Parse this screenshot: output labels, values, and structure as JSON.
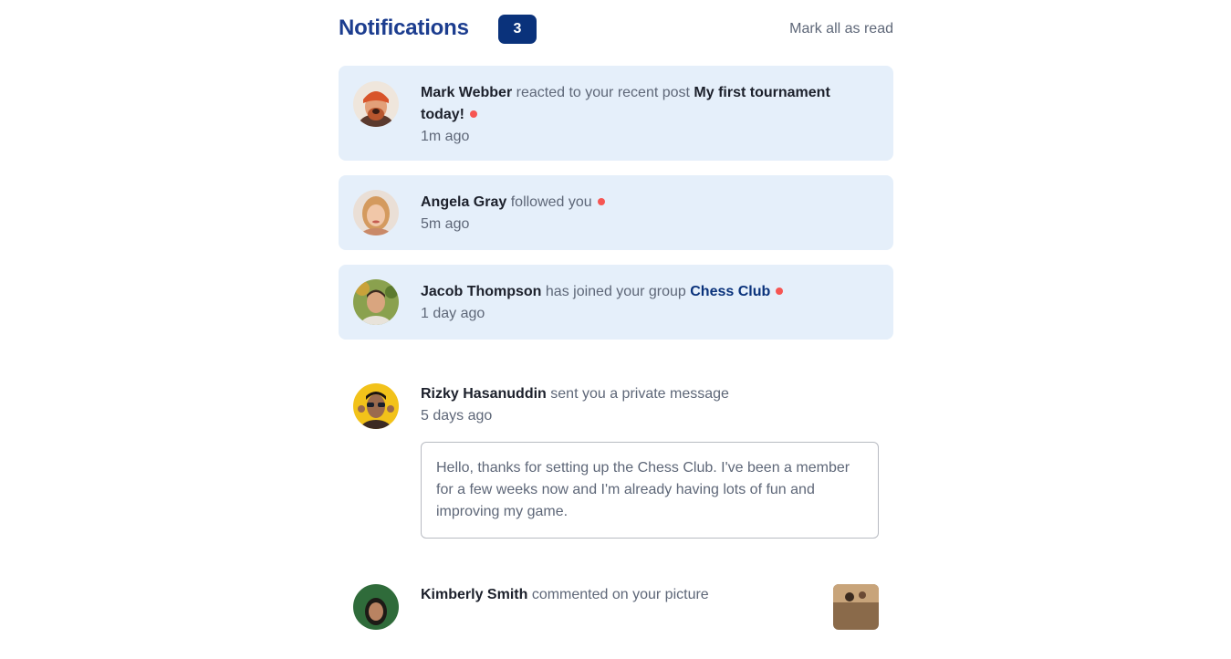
{
  "header": {
    "title": "Notifications",
    "unread_count": "3",
    "mark_all_label": "Mark all as read"
  },
  "notifications": [
    {
      "user": "Mark Webber",
      "action": "reacted to your recent post",
      "target": "My first tournament today!",
      "time": "1m ago"
    },
    {
      "user": "Angela Gray",
      "action": "followed you",
      "time": "5m ago"
    },
    {
      "user": "Jacob Thompson",
      "action": "has joined your group",
      "target": "Chess Club",
      "time": "1 day ago"
    },
    {
      "user": "Rizky Hasanuddin",
      "action": "sent you a private message",
      "time": "5 days ago",
      "message": "Hello, thanks for setting up the Chess Club. I've been a member for a few weeks now and I'm already having lots of fun and improving my game."
    },
    {
      "user": "Kimberly Smith",
      "action": "commented on your picture"
    }
  ],
  "colors": {
    "title": "#1c3d8f",
    "badge": "#0a327b",
    "unread_bg": "#e5effa",
    "dot": "#f65552"
  }
}
